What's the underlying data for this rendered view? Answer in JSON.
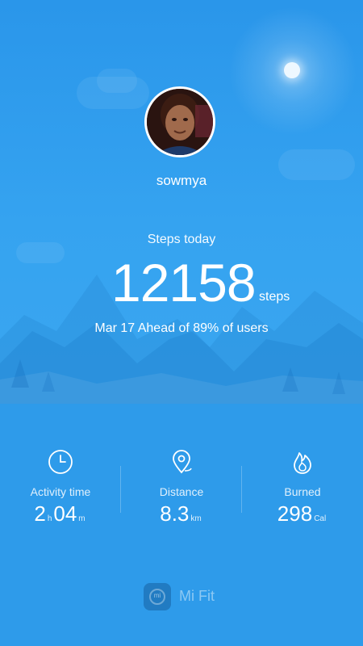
{
  "profile": {
    "username": "sowmya"
  },
  "steps": {
    "label": "Steps today",
    "value": "12158",
    "unit": "steps",
    "rank_text": "Mar 17 Ahead of 89% of users"
  },
  "stats": [
    {
      "label": "Activity time",
      "icon": "clock-icon",
      "value_parts": [
        "2",
        "h",
        "04",
        "m"
      ]
    },
    {
      "label": "Distance",
      "icon": "location-pin-icon",
      "value": "8.3",
      "unit": "km"
    },
    {
      "label": "Burned",
      "icon": "flame-icon",
      "value": "298",
      "unit": "Cal"
    }
  ],
  "brand": {
    "name": "Mi Fit",
    "logo_text": "mi"
  },
  "colors": {
    "background": "#2E9BEA",
    "text": "#FFFFFF"
  }
}
